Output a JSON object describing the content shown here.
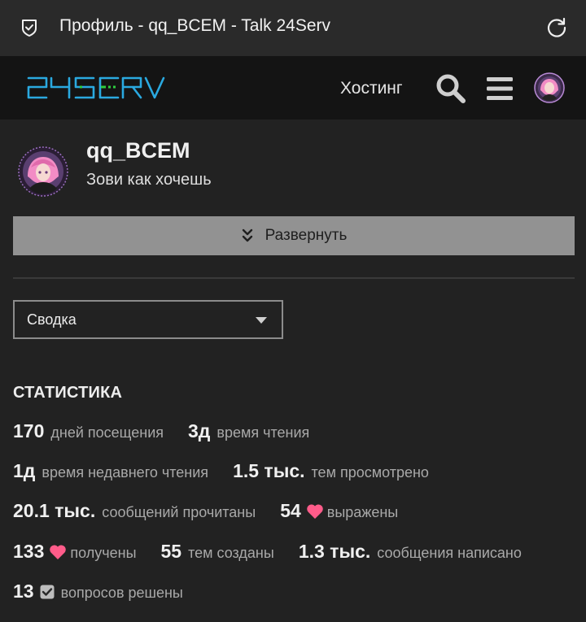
{
  "browser": {
    "page_title": "Профиль - qq_BCEM - Talk 24Serv"
  },
  "header": {
    "logo_text": "24SERV",
    "nav_hosting": "Хостинг"
  },
  "profile": {
    "username": "qq_BCEM",
    "title": "Зови как хочешь",
    "expand_label": "Развернуть",
    "select_value": "Сводка"
  },
  "stats": {
    "heading": "СТАТИСТИКА",
    "rows": [
      [
        {
          "value": "170",
          "label": "дней посещения"
        },
        {
          "value": "3д",
          "label": "время чтения"
        }
      ],
      [
        {
          "value": "1д",
          "label": "время недавнего чтения"
        },
        {
          "value": "1.5 тыс.",
          "label": "тем просмотрено"
        }
      ],
      [
        {
          "value": "20.1 тыс.",
          "label": "сообщений прочитаны"
        },
        {
          "value": "54",
          "icon": "heart-icon",
          "label": "выражены"
        }
      ],
      [
        {
          "value": "133",
          "icon": "heart-icon",
          "label": "получены"
        },
        {
          "value": "55",
          "label": "тем созданы"
        },
        {
          "value": "1.3 тыс.",
          "label": "сообщения написано"
        }
      ],
      [
        {
          "value": "13",
          "icon": "check-icon",
          "label": "вопросов решены"
        }
      ]
    ]
  },
  "colors": {
    "background": "#222222",
    "header": "#141414",
    "logo_blue": "#2aa9e0",
    "logo_green": "#2ecc40",
    "heart": "#ff5c8a",
    "expand_button": "#929292"
  }
}
